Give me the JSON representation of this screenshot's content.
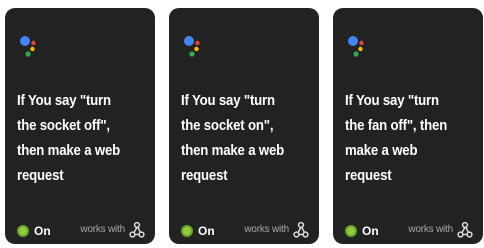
{
  "cards": [
    {
      "title": "If You say \"turn the socket off\", then make a web request",
      "status": "On",
      "works_with": "works with",
      "service_icon": "google-assistant-icon",
      "action_icon": "webhooks-icon"
    },
    {
      "title": "If You say \"turn the socket on\", then make a web request",
      "status": "On",
      "works_with": "works with",
      "service_icon": "google-assistant-icon",
      "action_icon": "webhooks-icon"
    },
    {
      "title": "If You say \"turn the fan off\", then make a web request",
      "status": "On",
      "works_with": "works with",
      "service_icon": "google-assistant-icon",
      "action_icon": "webhooks-icon"
    }
  ],
  "colors": {
    "card_background": "#222222",
    "toggle_on": "#8fcd3c",
    "ga_blue": "#4285f4",
    "ga_red": "#ea4335",
    "ga_yellow": "#fbbc05",
    "ga_green": "#34a853"
  }
}
